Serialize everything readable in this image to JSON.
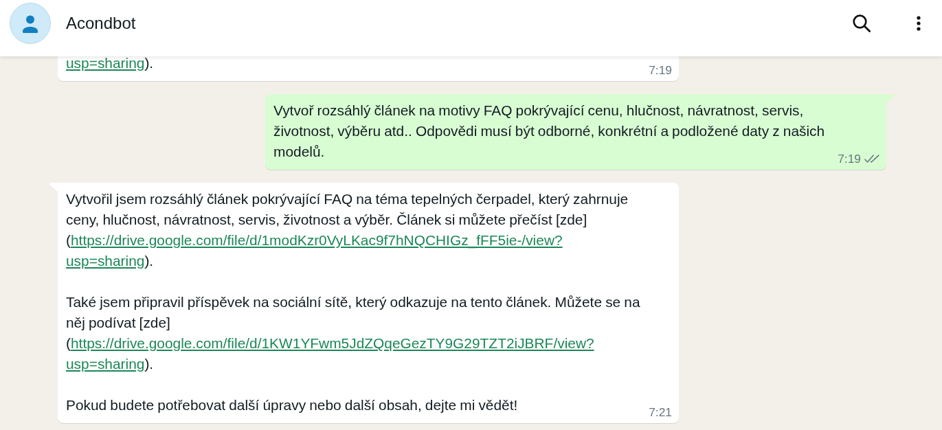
{
  "header": {
    "title": "Acondbot"
  },
  "messages": [
    {
      "outgoing": false,
      "tail": false,
      "time": "7:19",
      "paragraphs": [
        [
          {
            "kind": "link",
            "text": "usp=sharing"
          },
          {
            "kind": "text",
            "text": ")."
          }
        ]
      ]
    },
    {
      "outgoing": true,
      "tail": true,
      "time": "7:19",
      "read": false,
      "paragraphs": [
        [
          {
            "kind": "text",
            "text": "Vytvoř rozsáhlý článek na motivy FAQ pokrývající cenu, hlučnost, návratnost, servis, životnost, výběru atd.. Odpovědi musí být odborné, konkrétní a podložené daty z našich modelů."
          }
        ]
      ]
    },
    {
      "outgoing": false,
      "tail": true,
      "time": "7:21",
      "paragraphs": [
        [
          {
            "kind": "text",
            "text": "Vytvořil jsem rozsáhlý článek pokrývající FAQ na téma tepelných čerpadel, který zahrnuje ceny, hlučnost, návratnost, servis, životnost a výběr. Článek si můžete přečíst [zde] ("
          },
          {
            "kind": "link",
            "text": "https://drive.google.com/file/d/1modKzr0VyLKac9f7hNQCHIGz_fFF5ie-/view?"
          },
          {
            "kind": "link",
            "text": "usp=sharing"
          },
          {
            "kind": "text",
            "text": ")."
          }
        ],
        [
          {
            "kind": "text",
            "text": "Také jsem připravil příspěvek na sociální sítě, který odkazuje na tento článek. Můžete se na něj podívat [zde] ("
          },
          {
            "kind": "link",
            "text": "https://drive.google.com/file/d/1KW1YFwm5JdZQqeGezTY9G29TZT2iJBRF/view?"
          },
          {
            "kind": "link",
            "text": "usp=sharing"
          },
          {
            "kind": "text",
            "text": ")."
          }
        ],
        [
          {
            "kind": "text",
            "text": "Pokud budete potřebovat další úpravy nebo další obsah, dejte mi vědět!"
          }
        ]
      ]
    }
  ]
}
